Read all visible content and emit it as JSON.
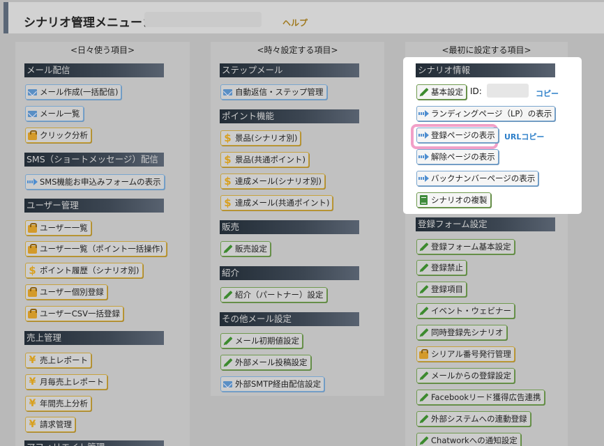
{
  "header": {
    "title": "シナリオ管理メニュー：",
    "help": "ヘルプ"
  },
  "columns": {
    "daily": {
      "title": "<日々使う項目>",
      "sections": {
        "mail": "メール配信",
        "sms": "SMS（ショートメッセージ）配信",
        "user": "ユーザー管理",
        "sales": "売上管理",
        "affiliate": "アフィリエイト管理"
      },
      "buttons": {
        "mail_create": "メール作成(一括配信)",
        "mail_list": "メール一覧",
        "click_analysis": "クリック分析",
        "sms_form": "SMS機能お申込みフォームの表示",
        "user_list": "ユーザー一覧",
        "user_list_points": "ユーザー一覧（ポイント一括操作)",
        "point_history": "ポイント履歴（シナリオ別)",
        "user_register": "ユーザー個別登録",
        "user_csv": "ユーザーCSV一括登録",
        "sales_report": "売上レポート",
        "monthly_report": "月毎売上レポート",
        "yearly_analysis": "年間売上分析",
        "billing": "請求管理"
      }
    },
    "periodic": {
      "title": "<時々設定する項目>",
      "sections": {
        "step": "ステップメール",
        "points": "ポイント機能",
        "sales": "販売",
        "referral": "紹介",
        "other_mail": "その他メール設定"
      },
      "buttons": {
        "auto_reply": "自動返信・ステップ管理",
        "prize_scenario": "景品(シナリオ別)",
        "prize_common": "景品(共通ポイント)",
        "achieve_mail_scenario": "達成メール(シナリオ別)",
        "achieve_mail_common": "達成メール(共通ポイント)",
        "sales_settings": "販売設定",
        "referral_partner": "紹介（パートナー）設定",
        "mail_defaults": "メール初期値設定",
        "external_post": "外部メール投稿設定",
        "external_smtp": "外部SMTP経由配信設定"
      }
    },
    "initial": {
      "title": "<最初に設定する項目>",
      "sections": {
        "scenario_info": "シナリオ情報",
        "reg_form": "登録フォーム設定"
      },
      "buttons": {
        "basic_settings": "基本設定",
        "id_label": "ID:",
        "copy": "コピー",
        "landing_page": "ランディングページ（LP）の表示",
        "reg_page": "登録ページの表示",
        "url_copy": "URLコピー",
        "unsub_page": "解除ページの表示",
        "backnumber": "バックナンバーページの表示",
        "duplicate": "シナリオの複製",
        "form_basic": "登録フォーム基本設定",
        "reg_ban": "登録禁止",
        "reg_items": "登録項目",
        "event_webinar": "イベント・ウェビナー",
        "simul_reg": "同時登録先シナリオ",
        "serial_number": "シリアル番号発行管理",
        "mail_reg": "メールからの登録設定",
        "facebook_lead": "Facebookリード獲得広告連携",
        "external_system": "外部システムへの連動登録",
        "chatwork": "Chatworkへの通知設定"
      }
    }
  }
}
